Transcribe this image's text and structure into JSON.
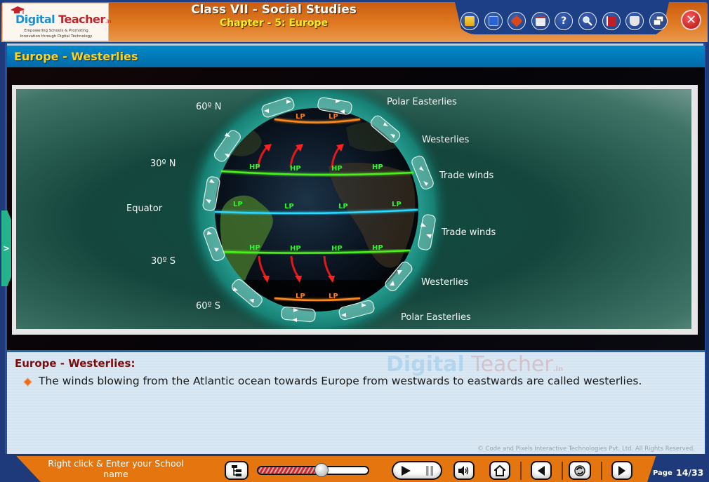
{
  "header": {
    "logo": {
      "word_part1": "Digital",
      "word_part2": " Teacher",
      "word_suffix": ".in",
      "tagline_line1": "Empowering Schools & Promoting",
      "tagline_line2": "Innovation through Digital Technology"
    },
    "course_title": "Class VII - Social Studies",
    "chapter_title": "Chapter - 5: Europe",
    "toolbar": [
      {
        "name": "progress-report",
        "icon": "folder-clock-icon"
      },
      {
        "name": "notebook",
        "icon": "notebook-icon"
      },
      {
        "name": "drawing-board",
        "icon": "pen-board-icon"
      },
      {
        "name": "worksheet",
        "icon": "worksheet-icon"
      },
      {
        "name": "help",
        "icon": "question-icon",
        "glyph": "?"
      },
      {
        "name": "search",
        "icon": "magnifier-icon"
      },
      {
        "name": "dictionary",
        "icon": "book-icon"
      },
      {
        "name": "glossary",
        "icon": "open-book-icon"
      },
      {
        "name": "window-toggle",
        "icon": "window-restore-icon"
      }
    ],
    "close_glyph": "✕"
  },
  "section": {
    "title": "Europe - Westerlies"
  },
  "diagram": {
    "latitude_labels": {
      "n60": "60º N",
      "n30": "30º N",
      "equator": "Equator",
      "s30": "30º S",
      "s60": "60º S"
    },
    "wind_labels": {
      "polar_easterlies_n": "Polar Easterlies",
      "westerlies_n": "Westerlies",
      "trade_winds_n": "Trade winds",
      "trade_winds_s": "Trade winds",
      "westerlies_s": "Westerlies",
      "polar_easterlies_s": "Polar Easterlies"
    },
    "pressure_belts": {
      "n60": [
        "LP",
        "LP"
      ],
      "n30": [
        "HP",
        "HP",
        "HP",
        "HP"
      ],
      "equator": [
        "LP",
        "LP",
        "LP",
        "LP"
      ],
      "s30": [
        "HP",
        "HP",
        "HP",
        "HP"
      ],
      "s60": [
        "LP",
        "LP"
      ]
    },
    "colors": {
      "polar_low": "#ff8a1a",
      "subtropical_high": "#4cf01c",
      "equator_line": "#29d8ff",
      "westerly_arrows": "#e01818"
    }
  },
  "side_tab": {
    "glyph": ">"
  },
  "notes": {
    "title": "Europe - Westerlies:",
    "bullets": [
      "The winds blowing from the Atlantic ocean towards Europe from westwards to eastwards are called westerlies."
    ],
    "watermark": {
      "part1": "Digital",
      "part2": " Teacher",
      "suffix": ".in"
    },
    "copyright": "© Code and Pixels Interactive Technologies  Pvt. Ltd. All Rights Reserved."
  },
  "footer": {
    "school_prompt": "Right click & Enter your School name",
    "media_progress": 0.58,
    "page_label": "Page",
    "page_value": "14/33",
    "controls": [
      "index",
      "play",
      "pause",
      "volume",
      "home",
      "previous",
      "replay",
      "next"
    ]
  }
}
